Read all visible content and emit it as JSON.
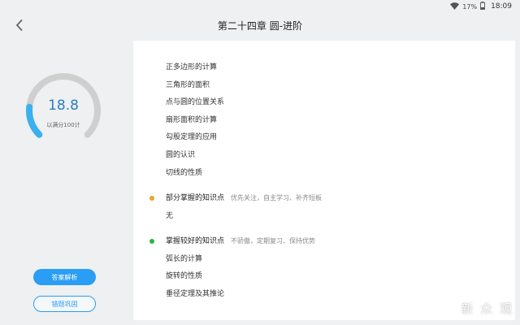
{
  "status_bar": {
    "battery_text": "17%",
    "time": "18:09"
  },
  "header": {
    "title": "第二十四章 圆-进阶"
  },
  "score": {
    "value": 18.8,
    "display": "18.8",
    "subtitle": "以满分100计",
    "max": 100
  },
  "buttons": {
    "analysis": "答案解析",
    "review": "错题巩固"
  },
  "weak_points": [
    "正多边形的计算",
    "三角形的面积",
    "点与圆的位置关系",
    "扇形面积的计算",
    "勾股定理的应用",
    "圆的认识",
    "切线的性质"
  ],
  "partial_section": {
    "title": "部分掌握的知识点",
    "hint": "优先关注，自主学习、补齐短板",
    "color": "#e8a727",
    "items": [
      "无"
    ]
  },
  "good_section": {
    "title": "掌握较好的知识点",
    "hint": "不骄傲，定期复习、保持优势",
    "color": "#2fb344",
    "items": [
      "弧长的计算",
      "旋转的性质",
      "垂径定理及其推论"
    ]
  },
  "colors": {
    "accent": "#2a9df4",
    "gauge_track": "#cfcfcf",
    "gauge_fill": "#3ab0ef"
  },
  "watermark": "新 众 观"
}
